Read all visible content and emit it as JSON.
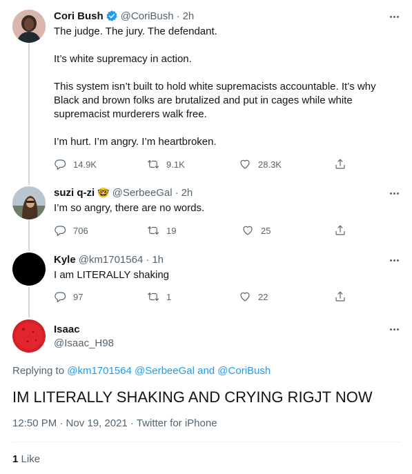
{
  "replies": [
    {
      "name": "Cori Bush",
      "verified": true,
      "handle": "@CoriBush",
      "time": "2h",
      "text": "The judge. The jury. The defendant.\n\nIt’s white supremacy in action.\n\nThis system isn’t built to hold white supremacists accountable. It’s why Black and brown folks are brutalized and put in cages while white supremacist murderers walk free.\n\nI’m hurt. I’m angry. I’m heartbroken.",
      "reply_count": "14.9K",
      "retweet_count": "9.1K",
      "like_count": "28.3K"
    },
    {
      "name": "suzi q-zi",
      "emoji": "🤓",
      "handle": "@SerbeeGal",
      "time": "2h",
      "text": "I’m so angry, there are no words.",
      "reply_count": "706",
      "retweet_count": "19",
      "like_count": "25"
    },
    {
      "name": "Kyle",
      "handle": "@km1701564",
      "time": "1h",
      "text": "I am LITERALLY shaking",
      "reply_count": "97",
      "retweet_count": "1",
      "like_count": "22"
    }
  ],
  "main_tweet": {
    "name": "Isaac",
    "handle": "@Isaac_H98",
    "replying_prefix": "Replying to",
    "replying_to": "@km1701564 @SerbeeGal and @CoriBush",
    "text": "IM LITERALLY SHAKING AND CRYING RIGJT NOW",
    "timestamp": "12:50 PM · Nov 19, 2021 · Twitter for iPhone",
    "like_count": "1",
    "like_label": "Like"
  },
  "colors": {
    "link": "#1d9bf0",
    "verified": "#1d9bf0",
    "secondary_text": "#536471",
    "isaac_avatar": "#d31f26"
  },
  "icons": [
    "verified-badge-icon",
    "reply-icon",
    "retweet-icon",
    "like-icon",
    "share-icon",
    "more-icon"
  ]
}
